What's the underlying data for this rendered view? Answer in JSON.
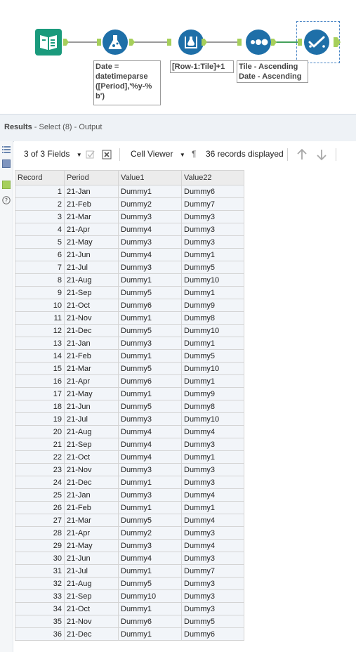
{
  "workflow": {
    "annotations": {
      "formula": "Date =\ndatetimeparse\n([Period],'%y-%\nb')",
      "multirow": "[Row-1:Tile]+1",
      "sort": "Tile - Ascending\nDate - Ascending"
    },
    "tool_icons": [
      "input-book-icon",
      "formula-flask-icon",
      "multirow-formula-icon",
      "sort-dots-icon",
      "select-check-icon"
    ]
  },
  "results": {
    "label": "Results",
    "source": " - Select (8) - Output"
  },
  "toolbar": {
    "fields": "3 of 3 Fields",
    "cell_viewer": "Cell Viewer",
    "pilcrow": "¶",
    "records": "36 records displayed"
  },
  "grid": {
    "columns": [
      "Record",
      "Period",
      "Value1",
      "Value22"
    ],
    "rows": [
      [
        "1",
        "21-Jan",
        "Dummy1",
        "Dummy6"
      ],
      [
        "2",
        "21-Feb",
        "Dummy2",
        "Dummy7"
      ],
      [
        "3",
        "21-Mar",
        "Dummy3",
        "Dummy3"
      ],
      [
        "4",
        "21-Apr",
        "Dummy4",
        "Dummy3"
      ],
      [
        "5",
        "21-May",
        "Dummy3",
        "Dummy3"
      ],
      [
        "6",
        "21-Jun",
        "Dummy4",
        "Dummy1"
      ],
      [
        "7",
        "21-Jul",
        "Dummy3",
        "Dummy5"
      ],
      [
        "8",
        "21-Aug",
        "Dummy1",
        "Dummy10"
      ],
      [
        "9",
        "21-Sep",
        "Dummy5",
        "Dummy1"
      ],
      [
        "10",
        "21-Oct",
        "Dummy6",
        "Dummy9"
      ],
      [
        "11",
        "21-Nov",
        "Dummy1",
        "Dummy8"
      ],
      [
        "12",
        "21-Dec",
        "Dummy5",
        "Dummy10"
      ],
      [
        "13",
        "21-Jan",
        "Dummy3",
        "Dummy1"
      ],
      [
        "14",
        "21-Feb",
        "Dummy1",
        "Dummy5"
      ],
      [
        "15",
        "21-Mar",
        "Dummy5",
        "Dummy10"
      ],
      [
        "16",
        "21-Apr",
        "Dummy6",
        "Dummy1"
      ],
      [
        "17",
        "21-May",
        "Dummy1",
        "Dummy9"
      ],
      [
        "18",
        "21-Jun",
        "Dummy5",
        "Dummy8"
      ],
      [
        "19",
        "21-Jul",
        "Dummy3",
        "Dummy10"
      ],
      [
        "20",
        "21-Aug",
        "Dummy4",
        "Dummy4"
      ],
      [
        "21",
        "21-Sep",
        "Dummy4",
        "Dummy3"
      ],
      [
        "22",
        "21-Oct",
        "Dummy4",
        "Dummy1"
      ],
      [
        "23",
        "21-Nov",
        "Dummy3",
        "Dummy3"
      ],
      [
        "24",
        "21-Dec",
        "Dummy1",
        "Dummy3"
      ],
      [
        "25",
        "21-Jan",
        "Dummy3",
        "Dummy4"
      ],
      [
        "26",
        "21-Feb",
        "Dummy1",
        "Dummy1"
      ],
      [
        "27",
        "21-Mar",
        "Dummy5",
        "Dummy4"
      ],
      [
        "28",
        "21-Apr",
        "Dummy2",
        "Dummy3"
      ],
      [
        "29",
        "21-May",
        "Dummy3",
        "Dummy4"
      ],
      [
        "30",
        "21-Jun",
        "Dummy4",
        "Dummy3"
      ],
      [
        "31",
        "21-Jul",
        "Dummy1",
        "Dummy7"
      ],
      [
        "32",
        "21-Aug",
        "Dummy5",
        "Dummy3"
      ],
      [
        "33",
        "21-Sep",
        "Dummy10",
        "Dummy3"
      ],
      [
        "34",
        "21-Oct",
        "Dummy1",
        "Dummy3"
      ],
      [
        "35",
        "21-Nov",
        "Dummy6",
        "Dummy5"
      ],
      [
        "36",
        "21-Dec",
        "Dummy1",
        "Dummy6"
      ]
    ]
  },
  "colors": {
    "tool_blue": "#1e6fa8",
    "input_teal": "#1a9a7c",
    "anchor_green": "#a6cf5b",
    "selection_blue": "#4b86c6"
  }
}
